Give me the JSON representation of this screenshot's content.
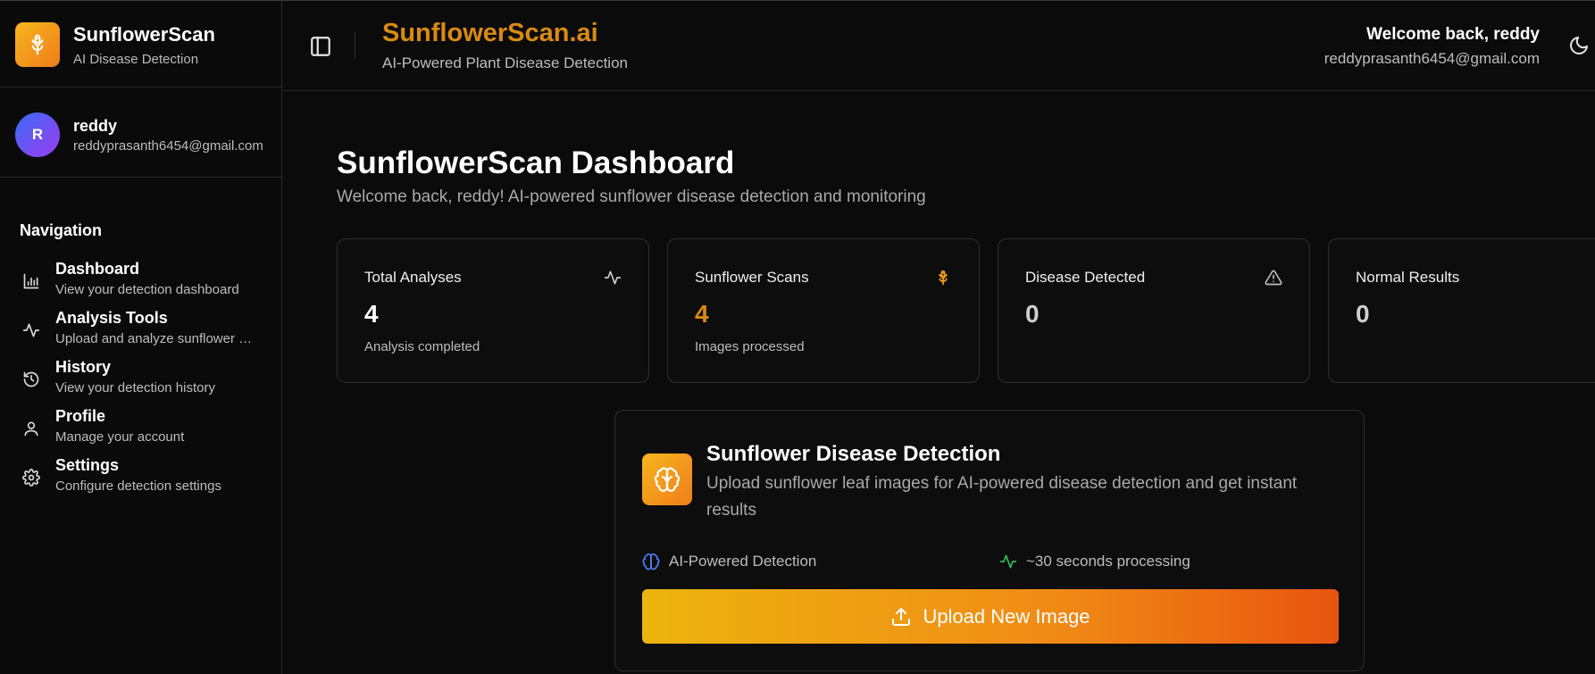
{
  "brand": {
    "name": "SunflowerScan",
    "subtitle": "AI Disease Detection",
    "logo_icon": "sunflower-icon",
    "accent": "#f6a61e"
  },
  "user": {
    "initial": "R",
    "name": "reddy",
    "email": "reddyprasanth6454@gmail.com"
  },
  "sidebar": {
    "nav_title": "Navigation",
    "items": [
      {
        "label": "Dashboard",
        "desc": "View your detection dashboard",
        "icon": "bar-chart-icon"
      },
      {
        "label": "Analysis Tools",
        "desc": "Upload and analyze sunflower leaf images",
        "icon": "activity-icon"
      },
      {
        "label": "History",
        "desc": "View your detection history",
        "icon": "history-icon"
      },
      {
        "label": "Profile",
        "desc": "Manage your account",
        "icon": "user-icon"
      },
      {
        "label": "Settings",
        "desc": "Configure detection settings",
        "icon": "gear-icon"
      }
    ]
  },
  "header": {
    "title": "SunflowerScan.ai",
    "subtitle": "AI-Powered Plant Disease Detection",
    "welcome": "Welcome back, reddy",
    "email": "reddyprasanth6454@gmail.com",
    "title_color": "#d98a12"
  },
  "main": {
    "title": "SunflowerScan Dashboard",
    "subtitle": "Welcome back, reddy! AI-powered sunflower disease detection and monitoring",
    "stats": [
      {
        "label": "Total Analyses",
        "value": "4",
        "note": "Analysis completed",
        "icon": "activity-icon"
      },
      {
        "label": "Sunflower Scans",
        "value": "4",
        "note": "Images processed",
        "icon": "sunflower-icon",
        "color": "#d98a12"
      },
      {
        "label": "Disease Detected",
        "value": "0",
        "note": "",
        "icon": "alert-triangle-icon"
      },
      {
        "label": "Normal Results",
        "value": "0",
        "note": "",
        "icon": ""
      }
    ],
    "detection": {
      "title": "Sunflower Disease Detection",
      "desc": "Upload sunflower leaf images for AI-powered disease detection and get instant results",
      "feature1": "AI-Powered Detection",
      "feature2": "~30 seconds processing",
      "upload_label": "Upload New Image",
      "icon": "brain-icon"
    }
  }
}
